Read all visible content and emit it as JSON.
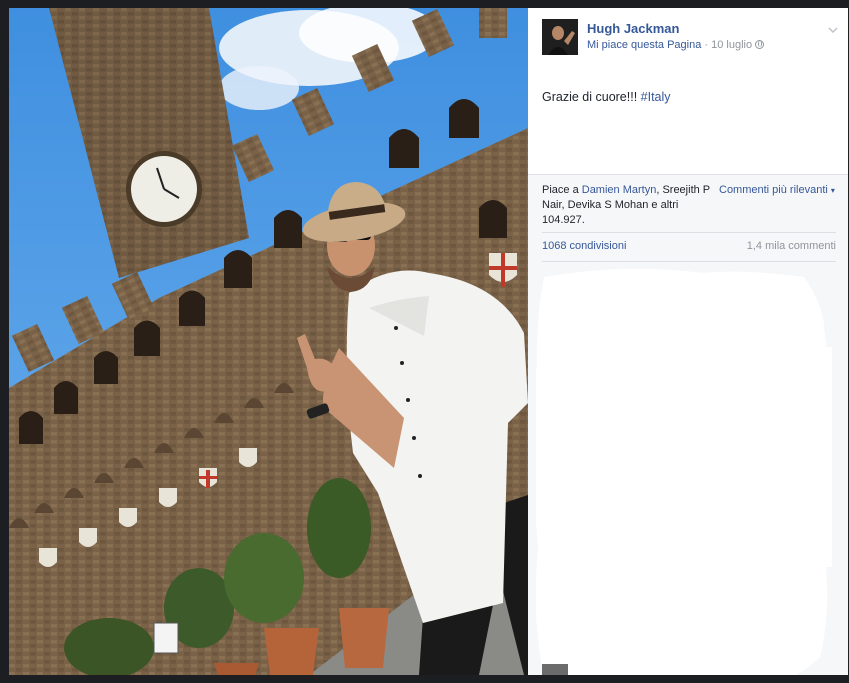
{
  "post": {
    "author": "Hugh Jackman",
    "page_like_label": "Mi piace questa Pagina",
    "separator": " · ",
    "date": "10 luglio",
    "text": "Grazie di cuore!!! ",
    "hashtag": "#Italy"
  },
  "reactions": {
    "prefix": "Piace a ",
    "liker1": "Damien Martyn",
    "rest": ", Sreejith P Nair, Devika S Mohan e altri 104.927.",
    "sort_label": "Commenti più rilevanti",
    "shares": "1068 condivisioni",
    "comments": "1,4 mila commenti"
  },
  "colors": {
    "link": "#365899",
    "muted": "#90949c",
    "sky": "#4a9ae8"
  },
  "icons": {
    "globe": "globe-icon",
    "chevron": "chevron-down-icon"
  }
}
